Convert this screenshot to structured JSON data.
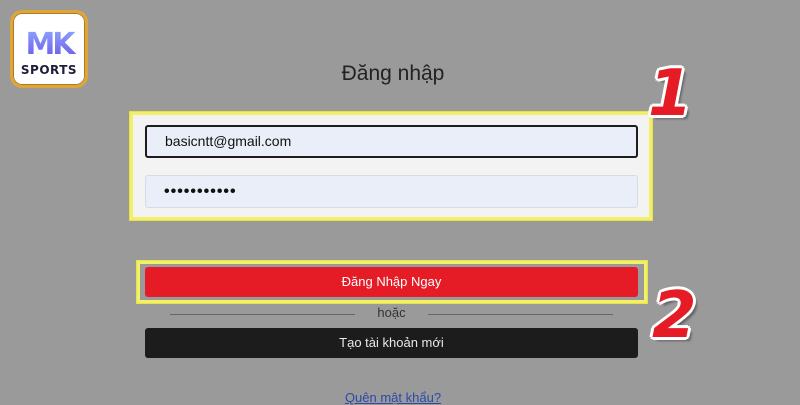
{
  "logo": {
    "mark": "MK",
    "sub": "SPORTS"
  },
  "title": "Đăng nhập",
  "form": {
    "email_value": "basicntt@gmail.com",
    "password_mask": "•••••••••••"
  },
  "buttons": {
    "login_label": "Đăng Nhập Ngay",
    "or_text": "hoặc",
    "create_label": "Tạo tài khoản mới"
  },
  "bottom_link": "Quên mật khẩu?",
  "annotations": {
    "step1": "1",
    "step2": "2"
  },
  "colors": {
    "background": "#9a9a9a",
    "login_button": "#e51b25",
    "create_button": "#1c1c1c",
    "highlight": "#f2f06a",
    "input_bg": "#e9eef9"
  }
}
